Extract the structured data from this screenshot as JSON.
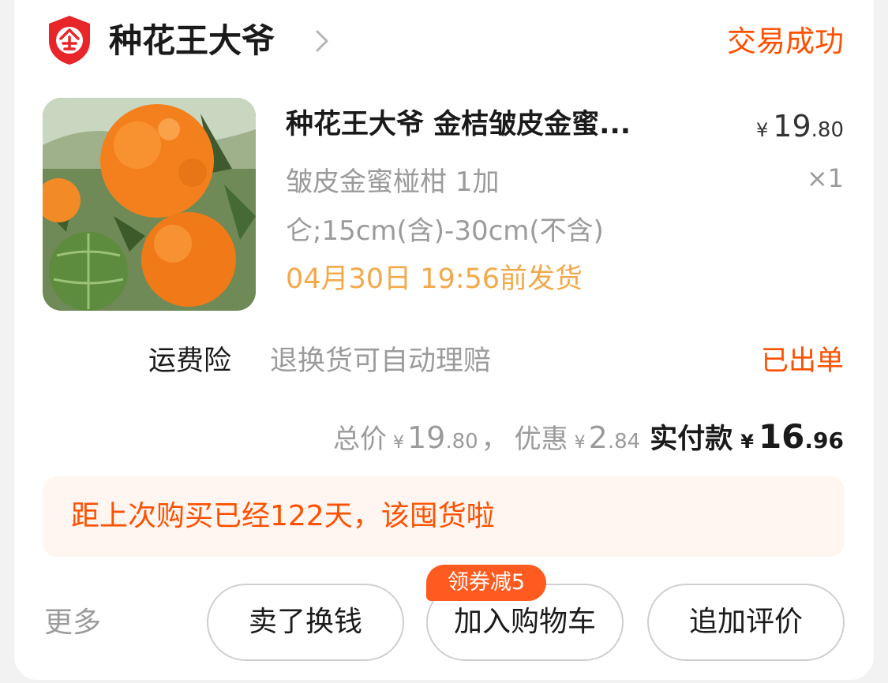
{
  "shop": {
    "name": "种花王大爷",
    "badge_glyph": "企",
    "status": "交易成功",
    "badge_color": "#e8262a"
  },
  "product": {
    "title": "种花王大爷  金桔皱皮金蜜...",
    "price": {
      "currency": "¥",
      "int": "19",
      "dec": ".80"
    },
    "sku": "皱皮金蜜椪柑 1加仑;15cm(含)-30cm(不含)",
    "quantity": "×1",
    "ship_time": "04月30日 19:56前发货"
  },
  "insurance": {
    "label": "运费险",
    "desc": "退换货可自动理赔",
    "status": "已出单"
  },
  "totals": {
    "total_label": "总价",
    "total_currency": "¥",
    "total_int": "19",
    "total_dec": ".80",
    "separator": "，",
    "discount_label": "优惠",
    "discount_currency": "¥",
    "discount_int": "2",
    "discount_dec": ".84",
    "paid_label": "实付款",
    "paid_currency": "¥",
    "paid_int": "16",
    "paid_dec": ".96"
  },
  "reminder": {
    "text": "距上次购买已经122天，该囤货啦"
  },
  "actions": {
    "more": "更多",
    "sell": "卖了换钱",
    "add_to_cart": "加入购物车",
    "review": "追加评价",
    "coupon_badge": "领券减5"
  },
  "colors": {
    "accent": "#ff5000",
    "ship_time": "#f3a94a",
    "banner_bg": "#fff6f1"
  }
}
